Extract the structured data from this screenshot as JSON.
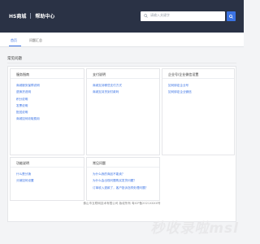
{
  "header": {
    "brand_name": "HS商城",
    "section_name": "帮助中心",
    "search_placeholder": "请输入关键字"
  },
  "tabs": [
    {
      "label": "首页",
      "active": true
    },
    {
      "label": "问题汇总",
      "active": false
    }
  ],
  "page_title": "常见问题",
  "cards": [
    {
      "title": "服务指南",
      "items": [
        "商城服务保障说明",
        "退换货说明",
        "积分说明",
        "发票说明",
        "配送说明",
        "商城如何收取费用"
      ]
    },
    {
      "title": "支付说明",
      "items": [
        "商城支持哪些支付方式",
        "商城支持货到付款吗"
      ]
    },
    {
      "title": "企业号/企业微信设置",
      "items": [
        "如何绑定企业号",
        "如何绑定企业微信"
      ]
    },
    {
      "title": "功能说明",
      "items": [
        "什么是分销",
        "分销如何设置"
      ]
    },
    {
      "title": "常见问题",
      "items": [
        "为什么我的商品不能卖？",
        "为什么会出现问题购买发货问题？",
        "订单收入退款了，客户投诉怎样处理问题？"
      ]
    }
  ],
  "footer": {
    "copyright": "佛山市互联网技术有限公司  版权所有  粤ICP备2021XXXX号"
  },
  "watermark": "秒收录啦msl",
  "colors": {
    "header_bg": "#2a3245",
    "accent": "#3b73e4",
    "page_bg": "#f3f4f6"
  }
}
